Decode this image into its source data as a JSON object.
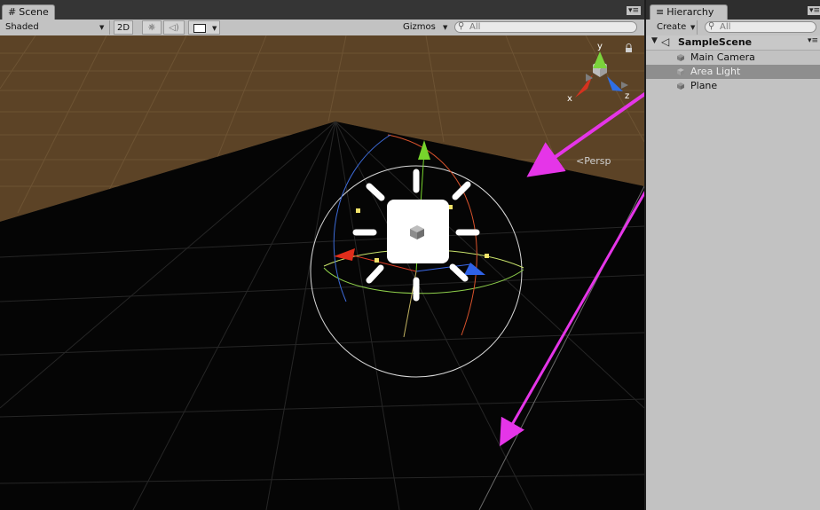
{
  "scene": {
    "tab_label": "Scene",
    "draw_mode": "Shaded",
    "mode_2d": "2D",
    "gizmos_label": "Gizmos",
    "search_placeholder": "All",
    "projection_label": "Persp",
    "axes": {
      "x": "x",
      "y": "y",
      "z": "z"
    }
  },
  "hierarchy": {
    "tab_label": "Hierarchy",
    "create_label": "Create",
    "search_placeholder": "All",
    "scene_name": "SampleScene",
    "items": [
      {
        "label": "Main Camera",
        "selected": false
      },
      {
        "label": "Area Light",
        "selected": true
      },
      {
        "label": "Plane",
        "selected": false
      }
    ]
  },
  "colors": {
    "annotation_arrow": "#e535e8",
    "ground_brown": "#5c4326",
    "plane_black": "#050505",
    "selection": "#8e8e8e"
  }
}
